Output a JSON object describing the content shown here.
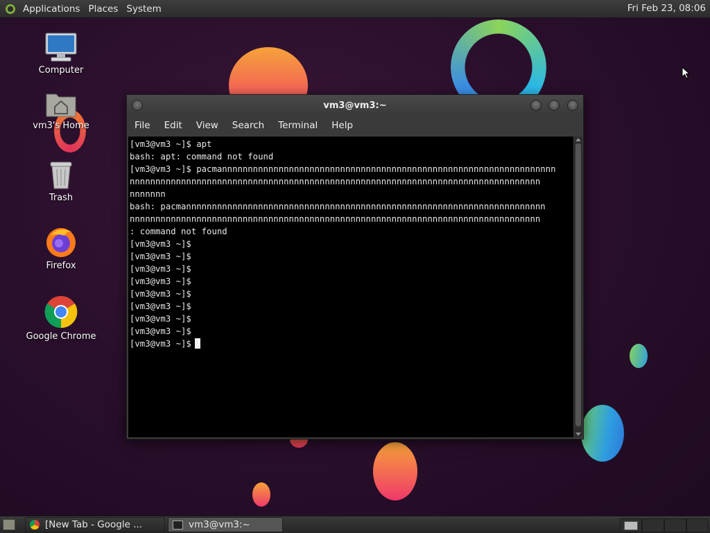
{
  "top_panel": {
    "menus": [
      "Applications",
      "Places",
      "System"
    ],
    "clock": "Fri Feb 23, 08:06"
  },
  "desktop": {
    "icons": [
      {
        "label": "Computer"
      },
      {
        "label": "vm3's Home"
      },
      {
        "label": "Trash"
      },
      {
        "label": "Firefox"
      },
      {
        "label": "Google Chrome"
      }
    ]
  },
  "terminal": {
    "title": "vm3@vm3:~",
    "menu": [
      "File",
      "Edit",
      "View",
      "Search",
      "Terminal",
      "Help"
    ],
    "lines": [
      "[vm3@vm3 ~]$ apt",
      "bash: apt: command not found",
      "[vm3@vm3 ~]$ pacmannnnnnnnnnnnnnnnnnnnnnnnnnnnnnnnnnnnnnnnnnnnnnnnnnnnnnnnnnnnnnnnn",
      "nnnnnnnnnnnnnnnnnnnnnnnnnnnnnnnnnnnnnnnnnnnnnnnnnnnnnnnnnnnnnnnnnnnnnnnnnnnnnnnn",
      "nnnnnnn",
      "bash: pacmannnnnnnnnnnnnnnnnnnnnnnnnnnnnnnnnnnnnnnnnnnnnnnnnnnnnnnnnnnnnnnnnnnnnn",
      "nnnnnnnnnnnnnnnnnnnnnnnnnnnnnnnnnnnnnnnnnnnnnnnnnnnnnnnnnnnnnnnnnnnnnnnnnnnnnnnn",
      ": command not found",
      "[vm3@vm3 ~]$",
      "[vm3@vm3 ~]$",
      "[vm3@vm3 ~]$",
      "[vm3@vm3 ~]$",
      "[vm3@vm3 ~]$",
      "[vm3@vm3 ~]$",
      "[vm3@vm3 ~]$",
      "[vm3@vm3 ~]$"
    ],
    "prompt": "[vm3@vm3 ~]$"
  },
  "taskbar": {
    "items": [
      {
        "label": "[New Tab - Google ...",
        "icon": "chrome-icon"
      },
      {
        "label": "vm3@vm3:~",
        "icon": "terminal-icon"
      }
    ]
  }
}
